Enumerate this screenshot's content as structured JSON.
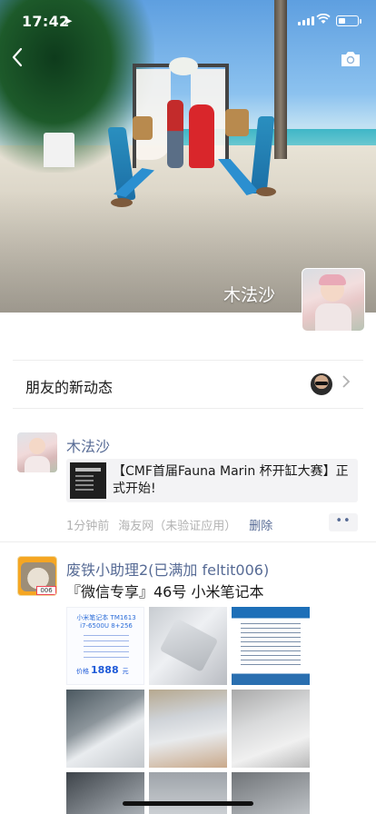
{
  "status_bar": {
    "time": "17:42"
  },
  "cover": {
    "user_name": "木法沙"
  },
  "new_posts": {
    "label": "朋友的新动态"
  },
  "posts": [
    {
      "author": "木法沙",
      "share_title": "【CMF首届Fauna Marin 杯开缸大赛】正式开始!",
      "time": "1分钟前",
      "source": "海友网（未验证应用）",
      "delete_label": "删除",
      "more_label": "••"
    },
    {
      "author": "废铁小助理2(已满加 feltit006)",
      "text": "『微信专享』46号 小米笔记本",
      "avatar_tag": "006",
      "poster_line1": "小米笔记本 TM1613",
      "poster_line2": "i7-6500U 8+256",
      "poster_price_prefix": "价格",
      "poster_price": "1888",
      "poster_price_unit": "元"
    }
  ],
  "colors": {
    "link": "#576b95",
    "meta": "#b2b2b2",
    "divider": "#ededed"
  },
  "icons": [
    "back-icon",
    "camera-icon",
    "chevron-right-icon",
    "location-arrow-icon",
    "wifi-icon",
    "battery-icon"
  ]
}
